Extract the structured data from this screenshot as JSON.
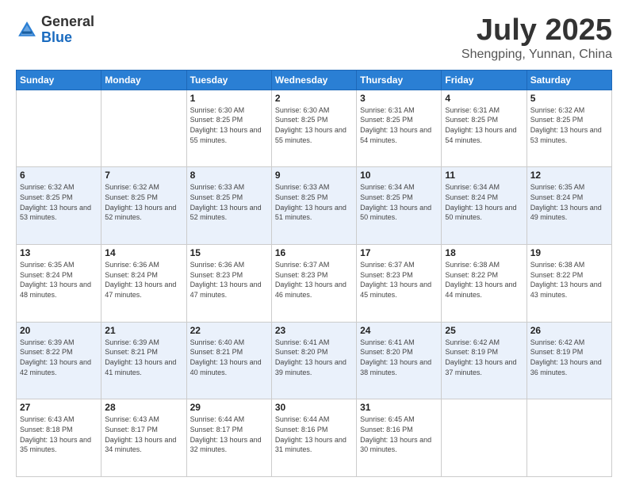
{
  "header": {
    "logo_general": "General",
    "logo_blue": "Blue",
    "main_title": "July 2025",
    "subtitle": "Shengping, Yunnan, China"
  },
  "weekdays": [
    "Sunday",
    "Monday",
    "Tuesday",
    "Wednesday",
    "Thursday",
    "Friday",
    "Saturday"
  ],
  "weeks": [
    [
      {
        "day": "",
        "sunrise": "",
        "sunset": "",
        "daylight": ""
      },
      {
        "day": "",
        "sunrise": "",
        "sunset": "",
        "daylight": ""
      },
      {
        "day": "1",
        "sunrise": "Sunrise: 6:30 AM",
        "sunset": "Sunset: 8:25 PM",
        "daylight": "Daylight: 13 hours and 55 minutes."
      },
      {
        "day": "2",
        "sunrise": "Sunrise: 6:30 AM",
        "sunset": "Sunset: 8:25 PM",
        "daylight": "Daylight: 13 hours and 55 minutes."
      },
      {
        "day": "3",
        "sunrise": "Sunrise: 6:31 AM",
        "sunset": "Sunset: 8:25 PM",
        "daylight": "Daylight: 13 hours and 54 minutes."
      },
      {
        "day": "4",
        "sunrise": "Sunrise: 6:31 AM",
        "sunset": "Sunset: 8:25 PM",
        "daylight": "Daylight: 13 hours and 54 minutes."
      },
      {
        "day": "5",
        "sunrise": "Sunrise: 6:32 AM",
        "sunset": "Sunset: 8:25 PM",
        "daylight": "Daylight: 13 hours and 53 minutes."
      }
    ],
    [
      {
        "day": "6",
        "sunrise": "Sunrise: 6:32 AM",
        "sunset": "Sunset: 8:25 PM",
        "daylight": "Daylight: 13 hours and 53 minutes."
      },
      {
        "day": "7",
        "sunrise": "Sunrise: 6:32 AM",
        "sunset": "Sunset: 8:25 PM",
        "daylight": "Daylight: 13 hours and 52 minutes."
      },
      {
        "day": "8",
        "sunrise": "Sunrise: 6:33 AM",
        "sunset": "Sunset: 8:25 PM",
        "daylight": "Daylight: 13 hours and 52 minutes."
      },
      {
        "day": "9",
        "sunrise": "Sunrise: 6:33 AM",
        "sunset": "Sunset: 8:25 PM",
        "daylight": "Daylight: 13 hours and 51 minutes."
      },
      {
        "day": "10",
        "sunrise": "Sunrise: 6:34 AM",
        "sunset": "Sunset: 8:25 PM",
        "daylight": "Daylight: 13 hours and 50 minutes."
      },
      {
        "day": "11",
        "sunrise": "Sunrise: 6:34 AM",
        "sunset": "Sunset: 8:24 PM",
        "daylight": "Daylight: 13 hours and 50 minutes."
      },
      {
        "day": "12",
        "sunrise": "Sunrise: 6:35 AM",
        "sunset": "Sunset: 8:24 PM",
        "daylight": "Daylight: 13 hours and 49 minutes."
      }
    ],
    [
      {
        "day": "13",
        "sunrise": "Sunrise: 6:35 AM",
        "sunset": "Sunset: 8:24 PM",
        "daylight": "Daylight: 13 hours and 48 minutes."
      },
      {
        "day": "14",
        "sunrise": "Sunrise: 6:36 AM",
        "sunset": "Sunset: 8:24 PM",
        "daylight": "Daylight: 13 hours and 47 minutes."
      },
      {
        "day": "15",
        "sunrise": "Sunrise: 6:36 AM",
        "sunset": "Sunset: 8:23 PM",
        "daylight": "Daylight: 13 hours and 47 minutes."
      },
      {
        "day": "16",
        "sunrise": "Sunrise: 6:37 AM",
        "sunset": "Sunset: 8:23 PM",
        "daylight": "Daylight: 13 hours and 46 minutes."
      },
      {
        "day": "17",
        "sunrise": "Sunrise: 6:37 AM",
        "sunset": "Sunset: 8:23 PM",
        "daylight": "Daylight: 13 hours and 45 minutes."
      },
      {
        "day": "18",
        "sunrise": "Sunrise: 6:38 AM",
        "sunset": "Sunset: 8:22 PM",
        "daylight": "Daylight: 13 hours and 44 minutes."
      },
      {
        "day": "19",
        "sunrise": "Sunrise: 6:38 AM",
        "sunset": "Sunset: 8:22 PM",
        "daylight": "Daylight: 13 hours and 43 minutes."
      }
    ],
    [
      {
        "day": "20",
        "sunrise": "Sunrise: 6:39 AM",
        "sunset": "Sunset: 8:22 PM",
        "daylight": "Daylight: 13 hours and 42 minutes."
      },
      {
        "day": "21",
        "sunrise": "Sunrise: 6:39 AM",
        "sunset": "Sunset: 8:21 PM",
        "daylight": "Daylight: 13 hours and 41 minutes."
      },
      {
        "day": "22",
        "sunrise": "Sunrise: 6:40 AM",
        "sunset": "Sunset: 8:21 PM",
        "daylight": "Daylight: 13 hours and 40 minutes."
      },
      {
        "day": "23",
        "sunrise": "Sunrise: 6:41 AM",
        "sunset": "Sunset: 8:20 PM",
        "daylight": "Daylight: 13 hours and 39 minutes."
      },
      {
        "day": "24",
        "sunrise": "Sunrise: 6:41 AM",
        "sunset": "Sunset: 8:20 PM",
        "daylight": "Daylight: 13 hours and 38 minutes."
      },
      {
        "day": "25",
        "sunrise": "Sunrise: 6:42 AM",
        "sunset": "Sunset: 8:19 PM",
        "daylight": "Daylight: 13 hours and 37 minutes."
      },
      {
        "day": "26",
        "sunrise": "Sunrise: 6:42 AM",
        "sunset": "Sunset: 8:19 PM",
        "daylight": "Daylight: 13 hours and 36 minutes."
      }
    ],
    [
      {
        "day": "27",
        "sunrise": "Sunrise: 6:43 AM",
        "sunset": "Sunset: 8:18 PM",
        "daylight": "Daylight: 13 hours and 35 minutes."
      },
      {
        "day": "28",
        "sunrise": "Sunrise: 6:43 AM",
        "sunset": "Sunset: 8:17 PM",
        "daylight": "Daylight: 13 hours and 34 minutes."
      },
      {
        "day": "29",
        "sunrise": "Sunrise: 6:44 AM",
        "sunset": "Sunset: 8:17 PM",
        "daylight": "Daylight: 13 hours and 32 minutes."
      },
      {
        "day": "30",
        "sunrise": "Sunrise: 6:44 AM",
        "sunset": "Sunset: 8:16 PM",
        "daylight": "Daylight: 13 hours and 31 minutes."
      },
      {
        "day": "31",
        "sunrise": "Sunrise: 6:45 AM",
        "sunset": "Sunset: 8:16 PM",
        "daylight": "Daylight: 13 hours and 30 minutes."
      },
      {
        "day": "",
        "sunrise": "",
        "sunset": "",
        "daylight": ""
      },
      {
        "day": "",
        "sunrise": "",
        "sunset": "",
        "daylight": ""
      }
    ]
  ]
}
